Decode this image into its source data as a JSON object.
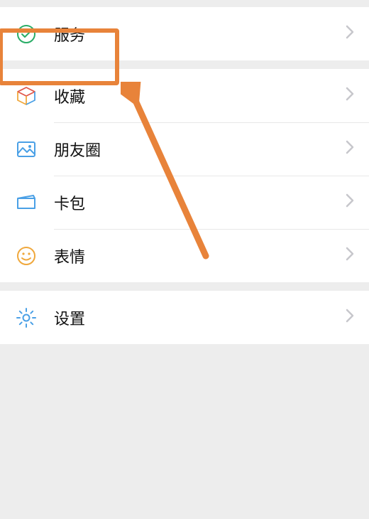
{
  "highlight_color": "#e8833a",
  "sections": [
    {
      "items": [
        {
          "id": "services",
          "label": "服务",
          "icon": "service-icon",
          "icon_color": "#2aad67"
        }
      ]
    },
    {
      "items": [
        {
          "id": "favorites",
          "label": "收藏",
          "icon": "cube-icon"
        },
        {
          "id": "moments",
          "label": "朋友圈",
          "icon": "photo-icon",
          "icon_color": "#4aa0e6"
        },
        {
          "id": "cards",
          "label": "卡包",
          "icon": "wallet-icon",
          "icon_color": "#4aa0e6"
        },
        {
          "id": "stickers",
          "label": "表情",
          "icon": "smile-icon",
          "icon_color": "#f0a83c"
        }
      ]
    },
    {
      "items": [
        {
          "id": "settings",
          "label": "设置",
          "icon": "gear-icon",
          "icon_color": "#4aa0e6"
        }
      ]
    }
  ]
}
